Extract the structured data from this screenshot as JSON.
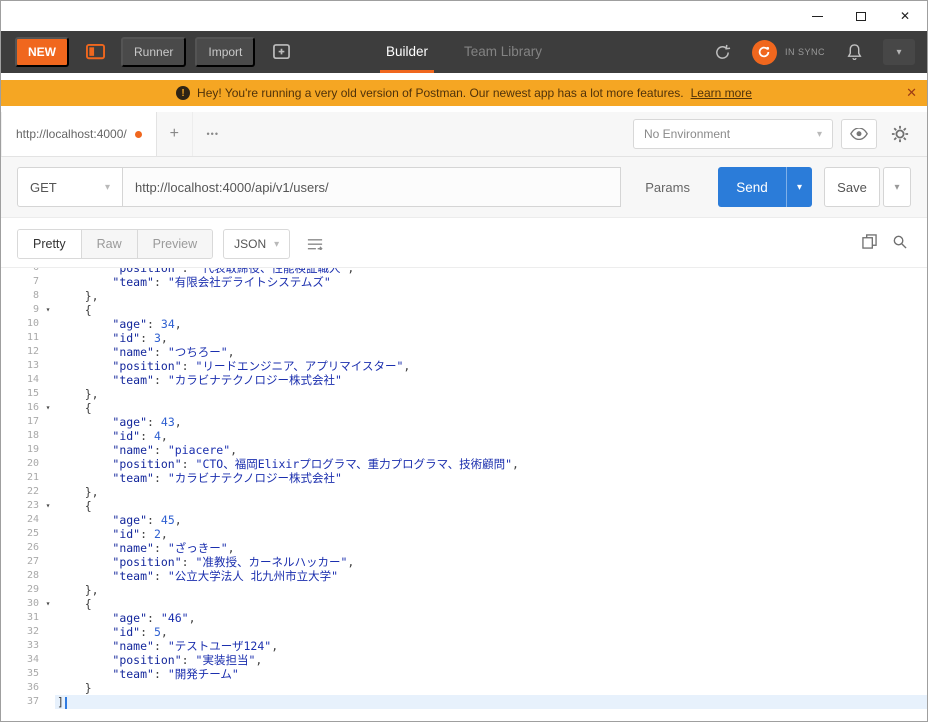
{
  "glyphs": {
    "close": "✕",
    "chevron_down": "▾",
    "plus": "+",
    "more": "•••",
    "bang": "!",
    "fold": "▾"
  },
  "colors": {
    "accent_orange": "#f0671e",
    "banner_orange": "#f5a623",
    "send_blue": "#2b7cd9"
  },
  "header": {
    "new": "NEW",
    "runner": "Runner",
    "import": "Import",
    "tab_builder": "Builder",
    "tab_team_library": "Team Library",
    "sync_status": "IN SYNC"
  },
  "banner": {
    "message": "Hey! You're running a very old version of Postman. Our newest app has a lot more features.",
    "link": "Learn more"
  },
  "tabs": {
    "active_tab": "http://localhost:4000/",
    "environment": "No Environment"
  },
  "request": {
    "method": "GET",
    "url": "http://localhost:4000/api/v1/users/",
    "params": "Params",
    "send": "Send",
    "save": "Save"
  },
  "response": {
    "views": [
      "Pretty",
      "Raw",
      "Preview"
    ],
    "format": "JSON"
  },
  "code": {
    "lines": [
      {
        "n": 6,
        "cut": true,
        "text": "        \"position\": \"代表取締役、性能検証職人\","
      },
      {
        "n": 7,
        "text": "        \"team\": \"有限会社デライトシステムズ\""
      },
      {
        "n": 8,
        "text": "    },"
      },
      {
        "n": 9,
        "fold": true,
        "text": "    {"
      },
      {
        "n": 10,
        "text": "        \"age\": 34,"
      },
      {
        "n": 11,
        "text": "        \"id\": 3,"
      },
      {
        "n": 12,
        "text": "        \"name\": \"つちろー\","
      },
      {
        "n": 13,
        "text": "        \"position\": \"リードエンジニア、アプリマイスター\","
      },
      {
        "n": 14,
        "text": "        \"team\": \"カラビナテクノロジー株式会社\""
      },
      {
        "n": 15,
        "text": "    },"
      },
      {
        "n": 16,
        "fold": true,
        "text": "    {"
      },
      {
        "n": 17,
        "text": "        \"age\": 43,"
      },
      {
        "n": 18,
        "text": "        \"id\": 4,"
      },
      {
        "n": 19,
        "text": "        \"name\": \"piacere\","
      },
      {
        "n": 20,
        "text": "        \"position\": \"CTO、福岡Elixirプログラマ、重力プログラマ、技術顧問\","
      },
      {
        "n": 21,
        "text": "        \"team\": \"カラビナテクノロジー株式会社\""
      },
      {
        "n": 22,
        "text": "    },"
      },
      {
        "n": 23,
        "fold": true,
        "text": "    {"
      },
      {
        "n": 24,
        "text": "        \"age\": 45,"
      },
      {
        "n": 25,
        "text": "        \"id\": 2,"
      },
      {
        "n": 26,
        "text": "        \"name\": \"ざっきー\","
      },
      {
        "n": 27,
        "text": "        \"position\": \"准教授、カーネルハッカー\","
      },
      {
        "n": 28,
        "text": "        \"team\": \"公立大学法人 北九州市立大学\""
      },
      {
        "n": 29,
        "text": "    },"
      },
      {
        "n": 30,
        "fold": true,
        "text": "    {"
      },
      {
        "n": 31,
        "text": "        \"age\": \"46\","
      },
      {
        "n": 32,
        "text": "        \"id\": 5,"
      },
      {
        "n": 33,
        "text": "        \"name\": \"テストユーザ124\","
      },
      {
        "n": 34,
        "text": "        \"position\": \"実装担当\","
      },
      {
        "n": 35,
        "text": "        \"team\": \"開発チーム\""
      },
      {
        "n": 36,
        "text": "    }"
      },
      {
        "n": 37,
        "caret": true,
        "text": "]"
      }
    ]
  }
}
